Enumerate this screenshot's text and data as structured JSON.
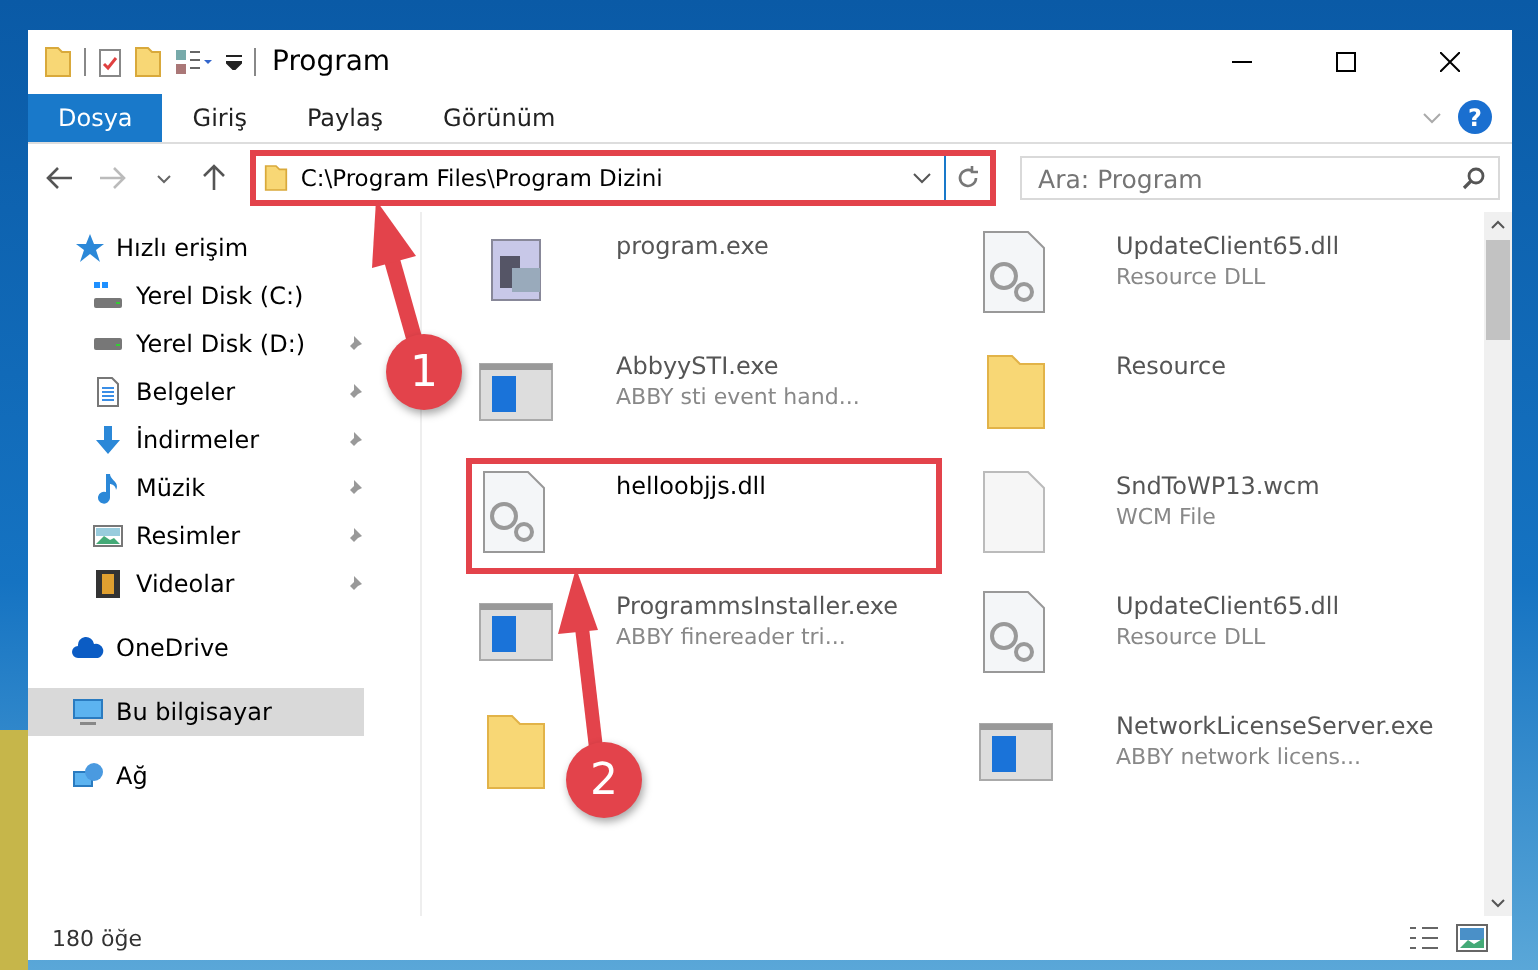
{
  "window": {
    "title": "Program"
  },
  "ribbon_tabs": [
    {
      "label": "Dosya",
      "selected": true
    },
    {
      "label": "Giriş",
      "selected": false
    },
    {
      "label": "Paylaş",
      "selected": false
    },
    {
      "label": "Görünüm",
      "selected": false
    }
  ],
  "help": "?",
  "address": {
    "value": "C:\\Program Files\\Program Dizini",
    "highlighted": true
  },
  "search": {
    "placeholder": "Ara: Program"
  },
  "sidebar": {
    "items": [
      {
        "label": "Hızlı erişim",
        "kind": "quick",
        "pinned": false,
        "selected": false,
        "children": [
          {
            "label": "Yerel Disk (C:)",
            "kind": "diskc",
            "pinned": false,
            "selected": false
          },
          {
            "label": "Yerel Disk (D:)",
            "kind": "disk",
            "pinned": true,
            "selected": false
          },
          {
            "label": "Belgeler",
            "kind": "docs",
            "pinned": true,
            "selected": false
          },
          {
            "label": "İndirmeler",
            "kind": "downloads",
            "pinned": true,
            "selected": false
          },
          {
            "label": "Müzik",
            "kind": "music",
            "pinned": true,
            "selected": false
          },
          {
            "label": "Resimler",
            "kind": "pictures",
            "pinned": true,
            "selected": false
          },
          {
            "label": "Videolar",
            "kind": "videos",
            "pinned": true,
            "selected": false
          }
        ]
      },
      {
        "label": "OneDrive",
        "kind": "cloud",
        "pinned": false,
        "selected": false
      },
      {
        "label": "Bu bilgisayar",
        "kind": "pc",
        "pinned": false,
        "selected": true
      },
      {
        "label": "Ağ",
        "kind": "network",
        "pinned": false,
        "selected": false
      }
    ]
  },
  "files": [
    {
      "name": "program.exe",
      "kind": "app",
      "highlighted": false
    },
    {
      "name": "UpdateClient65.dll",
      "description": "Resource DLL",
      "kind": "dll",
      "highlighted": false
    },
    {
      "name": "AbbyySTI.exe",
      "description": "ABBY sti event hand...",
      "kind": "window",
      "highlighted": false
    },
    {
      "name": "Resource",
      "kind": "folder",
      "highlighted": false
    },
    {
      "name": "helloobjjs.dll",
      "kind": "dll",
      "highlighted": true
    },
    {
      "name": "SndToWP13.wcm",
      "description": "WCM File",
      "kind": "blank",
      "highlighted": false
    },
    {
      "name": "ProgrammsInstaller.exe",
      "description": "ABBY finereader tri...",
      "kind": "window",
      "highlighted": false
    },
    {
      "name": "UpdateClient65.dll",
      "description": "Resource DLL",
      "kind": "dll",
      "highlighted": false
    },
    {
      "kind": "folder",
      "highlighted": false
    },
    {
      "name": "NetworkLicenseServer.exe",
      "description": "ABBY network licens...",
      "kind": "window",
      "highlighted": false
    }
  ],
  "status_bar": {
    "count": "180 öğe"
  },
  "annotations": [
    {
      "label": "1"
    },
    {
      "label": "2"
    }
  ]
}
